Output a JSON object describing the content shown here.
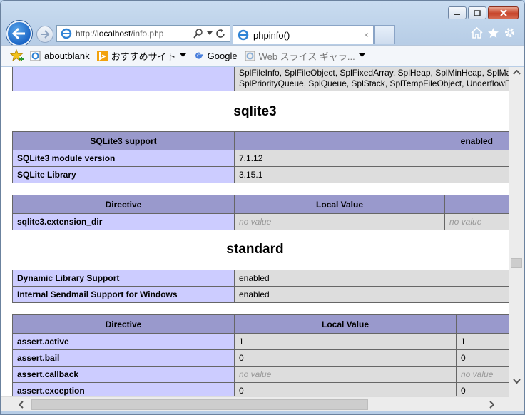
{
  "browser": {
    "address_prefix": "http://",
    "address_host": "localhost",
    "address_path": "/info.php",
    "tab_title": "phpinfo()",
    "tab_close": "×",
    "favorites": [
      {
        "label": "aboutblank",
        "icon": "ie-page-icon"
      },
      {
        "label": "おすすめサイト",
        "icon": "bing-icon"
      },
      {
        "label": "Google",
        "icon": "google-icon"
      },
      {
        "label": "Web スライス ギャラ...",
        "icon": "web-slice-icon"
      }
    ]
  },
  "page": {
    "spl_row": {
      "line1": "SplFileInfo, SplFileObject, SplFixedArray, SplHeap, SplMinHeap, SplMa",
      "line2": "SplPriorityQueue, SplQueue, SplStack, SplTempFileObject, UnderflowE"
    },
    "sqlite3": {
      "title": "sqlite3",
      "info_header": {
        "name": "SQLite3 support",
        "value": "enabled"
      },
      "info_rows": [
        {
          "name": "SQLite3 module version",
          "value": "7.1.12"
        },
        {
          "name": "SQLite Library",
          "value": "3.15.1"
        }
      ],
      "directive_header": {
        "directive": "Directive",
        "local": "Local Value"
      },
      "directive_rows": [
        {
          "name": "sqlite3.extension_dir",
          "local": "no value",
          "master": "no value"
        }
      ]
    },
    "standard": {
      "title": "standard",
      "info_rows": [
        {
          "name": "Dynamic Library Support",
          "value": "enabled"
        },
        {
          "name": "Internal Sendmail Support for Windows",
          "value": "enabled"
        }
      ],
      "directive_header": {
        "directive": "Directive",
        "local": "Local Value"
      },
      "directive_rows": [
        {
          "name": "assert.active",
          "local": "1",
          "master": "1"
        },
        {
          "name": "assert.bail",
          "local": "0",
          "master": "0"
        },
        {
          "name": "assert.callback",
          "local": "no value",
          "master": "no value"
        },
        {
          "name": "assert.exception",
          "local": "0",
          "master": "0"
        }
      ]
    }
  }
}
